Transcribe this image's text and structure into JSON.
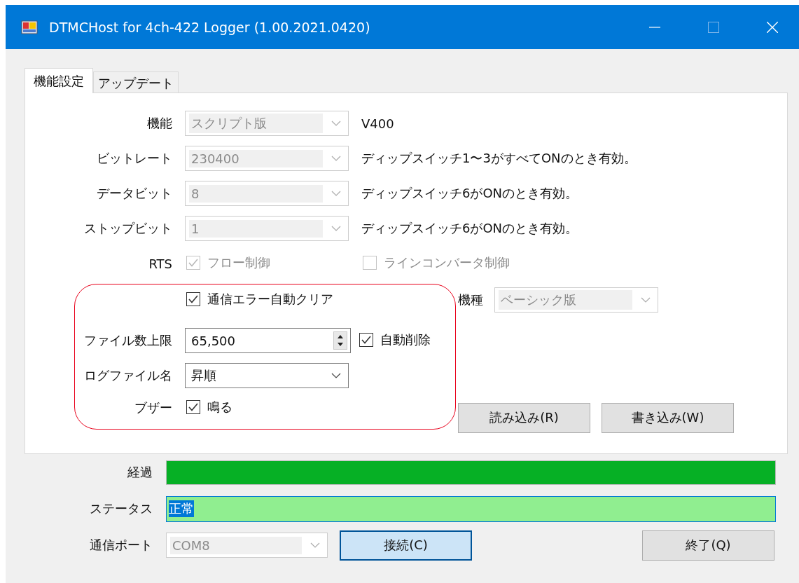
{
  "window": {
    "title": "DTMCHost for 4ch-422 Logger (1.00.2021.0420)"
  },
  "tabs": [
    {
      "label": "機能設定",
      "selected": true
    },
    {
      "label": "アップデート",
      "selected": false
    }
  ],
  "settings": [
    {
      "label": "機能",
      "value": "スクリプト版",
      "disabled": true,
      "note": "V400"
    },
    {
      "label": "ビットレート",
      "value": "230400",
      "disabled": true,
      "note": "ディップスイッチ1〜3がすべてONのとき有効。"
    },
    {
      "label": "データビット",
      "value": "8",
      "disabled": true,
      "note": "ディップスイッチ6がONのとき有効。"
    },
    {
      "label": "ストップビット",
      "value": "1",
      "disabled": true,
      "note": "ディップスイッチ6がONのとき有効。"
    }
  ],
  "rts": {
    "label": "RTS",
    "options": [
      {
        "label": "フロー制御",
        "checked": true,
        "disabled": true
      },
      {
        "label": "ラインコンバータ制御",
        "checked": false,
        "disabled": true
      }
    ]
  },
  "auto_clear": {
    "label": "通信エラー自動クリア",
    "checked": true
  },
  "model": {
    "label": "機種",
    "value": "ベーシック版",
    "disabled": true
  },
  "file_limit": {
    "label": "ファイル数上限",
    "value": "65,500",
    "auto_delete": {
      "label": "自動削除",
      "checked": true
    }
  },
  "log_file_name": {
    "label": "ログファイル名",
    "value": "昇順",
    "disabled": false
  },
  "buzzer": {
    "label": "ブザー",
    "option": {
      "label": "鳴る",
      "checked": true
    }
  },
  "buttons": [
    "読み込み(R)",
    "書き込み(W)"
  ],
  "progress": {
    "label": "経過",
    "level": 1
  },
  "status": {
    "label": "ステータス",
    "value": "正常",
    "text_selected": true
  },
  "port": {
    "label": "通信ポート",
    "value": "COM8",
    "disabled": true
  },
  "connect_button": {
    "label": "接続(C)",
    "focused": true
  },
  "quit_button": {
    "label": "終了(Q)"
  }
}
